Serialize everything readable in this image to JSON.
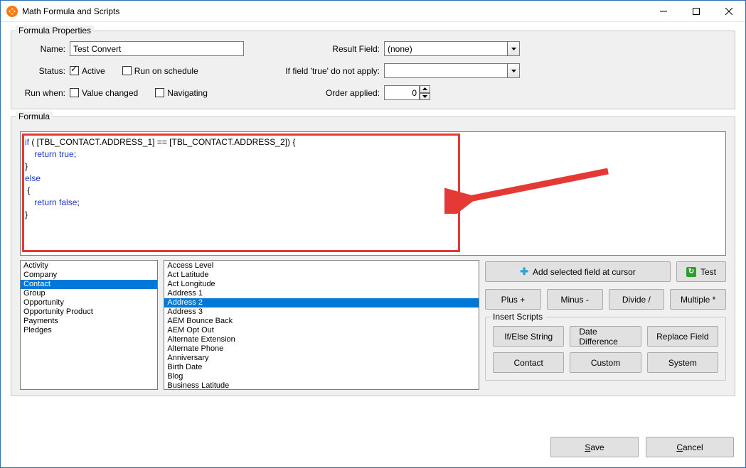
{
  "window": {
    "title": "Math Formula and Scripts"
  },
  "group1": {
    "legend": "Formula Properties",
    "name_label": "Name:",
    "name_value": "Test Convert",
    "status_label": "Status:",
    "active_label": "Active",
    "run_on_schedule_label": "Run on schedule",
    "run_when_label": "Run when:",
    "value_changed_label": "Value changed",
    "navigating_label": "Navigating",
    "result_field_label": "Result Field:",
    "result_field_value": "(none)",
    "if_true_label": "If field 'true' do not apply:",
    "if_true_value": "",
    "order_label": "Order applied:",
    "order_value": "0"
  },
  "group2": {
    "legend": "Formula",
    "code_tokens": [
      {
        "t": "kw",
        "v": "if"
      },
      {
        "t": "p",
        "v": " ( [TBL_CONTACT.ADDRESS_1] == [TBL_CONTACT.ADDRESS_2]) {\n    "
      },
      {
        "t": "kw",
        "v": "return true"
      },
      {
        "t": "p",
        "v": ";\n}\n"
      },
      {
        "t": "kw",
        "v": "else"
      },
      {
        "t": "p",
        "v": "\n {\n    "
      },
      {
        "t": "kw",
        "v": "return false"
      },
      {
        "t": "p",
        "v": ";\n}\n"
      }
    ]
  },
  "tables": {
    "items": [
      "Activity",
      "Company",
      "Contact",
      "Group",
      "Opportunity",
      "Opportunity Product",
      "Payments",
      "Pledges"
    ],
    "selected_index": 2
  },
  "fields": {
    "items": [
      "Access Level",
      "Act Latitude",
      "Act Longitude",
      "Address 1",
      "Address 2",
      "Address 3",
      "AEM Bounce Back",
      "AEM Opt Out",
      "Alternate Extension",
      "Alternate Phone",
      "Anniversary",
      "Birth Date",
      "Blog",
      "Business Latitude"
    ],
    "selected_index": 4
  },
  "buttons": {
    "add_field": "Add selected field at cursor",
    "test": "Test",
    "plus": "Plus +",
    "minus": "Minus -",
    "divide": "Divide /",
    "multiple": "Multiple *"
  },
  "scripts": {
    "legend": "Insert Scripts",
    "ifelse": "If/Else String",
    "datediff": "Date Difference",
    "replace": "Replace Field",
    "contact": "Contact",
    "custom": "Custom",
    "system": "System"
  },
  "footer": {
    "save": "Save",
    "save_accel": "S",
    "cancel": "Cancel",
    "cancel_accel": "C"
  }
}
